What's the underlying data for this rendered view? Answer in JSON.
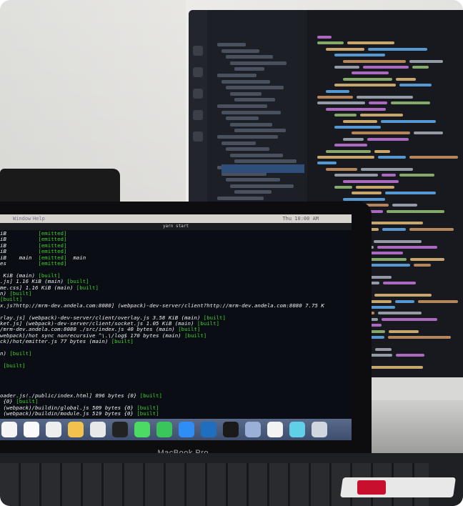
{
  "laptop": {
    "brand": "MacBook Pro",
    "menubar": {
      "items": [
        "Window",
        "Help"
      ],
      "clock": "Thu 10:00 AM"
    },
    "terminal": {
      "window_title": "yarn start",
      "lines": [
        {
          "pre": "iB          ",
          "tag": "[emitted]",
          "post": ""
        },
        {
          "pre": "iB          ",
          "tag": "[emitted]",
          "post": ""
        },
        {
          "pre": "iB          ",
          "tag": "[emitted]",
          "post": ""
        },
        {
          "pre": "iB          ",
          "tag": "[emitted]",
          "post": ""
        },
        {
          "pre": "iB    main  ",
          "tag": "[emitted]",
          "post": "  main"
        },
        {
          "pre": "es          ",
          "tag": "[emitted]",
          "post": ""
        },
        {
          "pre": "",
          "tag": "",
          "post": ""
        },
        {
          "pre": " KiB (main) ",
          "tag": "[built]",
          "post": ""
        },
        {
          "pre": ".js] 1.16 KiB (main) ",
          "tag": "[built]",
          "post": ""
        },
        {
          "pre": "me.css] 1.16 KiB (main) ",
          "tag": "[built]",
          "post": ""
        },
        {
          "pre": "n) ",
          "tag": "[built]",
          "post": ""
        },
        {
          "pre": "",
          "tag": "[built]",
          "post": ""
        },
        {
          "pre": "x.js?http://mrm-dev.andela.com:8080] (webpack)-dev-server/client?http://mrm-dev.andela.com:8080 7.75 K",
          "tag": "",
          "post": ""
        },
        {
          "pre": "",
          "tag": "",
          "post": ""
        },
        {
          "pre": "rlay.js] (webpack)-dev-server/client/overlay.js 3.58 KiB (main) ",
          "tag": "[built]",
          "post": ""
        },
        {
          "pre": "ket.js] (webpack)-dev-server/client/socket.js 1.05 KiB (main) ",
          "tag": "[built]",
          "post": ""
        },
        {
          "pre": "/mrm-dev.andela.com:8080 ./src/index.js 40 bytes (main) ",
          "tag": "[built]",
          "post": ""
        },
        {
          "pre": "webpack)/hot sync nonrecursive ^\\.\\/log$ 170 bytes (main) ",
          "tag": "[built]",
          "post": ""
        },
        {
          "pre": "ck)/hot/emitter.js 77 bytes (main) ",
          "tag": "[built]",
          "post": ""
        },
        {
          "pre": "",
          "tag": "",
          "post": ""
        },
        {
          "pre": "n) ",
          "tag": "[built]",
          "post": ""
        },
        {
          "pre": "",
          "tag": "",
          "post": ""
        },
        {
          "pre": " ",
          "tag": "[built]",
          "post": ""
        },
        {
          "pre": "",
          "tag": "",
          "post": ""
        },
        {
          "pre": "",
          "tag": "",
          "post": ""
        },
        {
          "pre": "",
          "tag": "",
          "post": ""
        },
        {
          "pre": "",
          "tag": "",
          "post": ""
        },
        {
          "pre": "oader.js!./public/index.html] 896 bytes {0} ",
          "tag": "[built]",
          "post": ""
        },
        {
          "pre": " {0} ",
          "tag": "[built]",
          "post": ""
        },
        {
          "pre": " (webpack)/buildin/global.js 509 bytes {0} ",
          "tag": "[built]",
          "post": ""
        },
        {
          "pre": " (webpack)/buildin/module.js 519 bytes {0} ",
          "tag": "[built]",
          "post": ""
        }
      ]
    },
    "dock_icons": [
      "calendar-icon",
      "notes-icon",
      "reminders-icon",
      "photos-icon",
      "slack-icon",
      "terminal-icon",
      "messages-icon",
      "facetime-icon",
      "app-store-icon",
      "vscode-icon",
      "terminal-2-icon",
      "launchpad-icon",
      "music-icon",
      "preview-icon",
      "trash-icon"
    ]
  },
  "colors": {
    "terminal_green": "#3fd12a",
    "code_keyword": "#c678dd",
    "code_string": "#98c379",
    "code_tag": "#e5c07b",
    "code_attr": "#61afef"
  }
}
